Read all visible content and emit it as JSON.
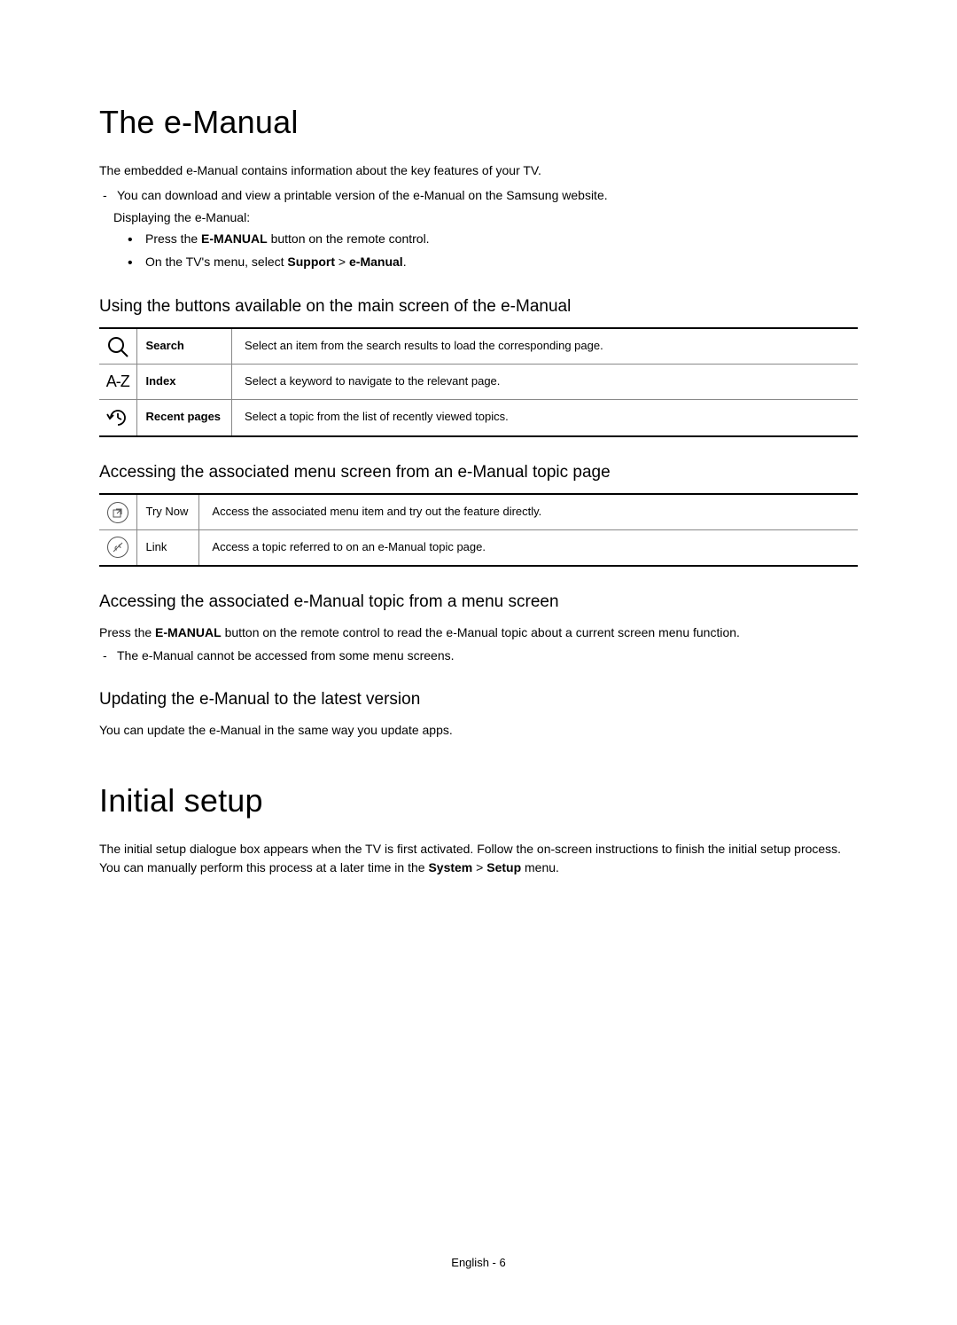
{
  "h1_emanual": "The e-Manual",
  "intro_emanual": "The embedded e-Manual contains information about the key features of your TV.",
  "dash_download": "You can download and view a printable version of the e-Manual on the Samsung website.",
  "displaying_line": "Displaying the e-Manual:",
  "bullet_press_1": "Press the ",
  "bullet_press_bold": "E-MANUAL",
  "bullet_press_2": " button on the remote control.",
  "bullet_menu_1": "On the TV's menu, select ",
  "bullet_menu_bold1": "Support",
  "bullet_menu_gt": " > ",
  "bullet_menu_bold2": "e-Manual",
  "bullet_menu_2": ".",
  "h2_using": "Using the buttons available on the main screen of the e-Manual",
  "table1": {
    "rows": [
      {
        "label": "Search",
        "desc": "Select an item from the search results to load the corresponding page."
      },
      {
        "label": "Index",
        "desc": "Select a keyword to navigate to the relevant page."
      },
      {
        "label": "Recent pages",
        "desc": "Select a topic from the list of recently viewed topics."
      }
    ]
  },
  "h2_accessing_menu": "Accessing the associated menu screen from an e-Manual topic page",
  "table2": {
    "rows": [
      {
        "label": "Try Now",
        "desc": "Access the associated menu item and try out the feature directly."
      },
      {
        "label": "Link",
        "desc": "Access a topic referred to on an e-Manual topic page."
      }
    ]
  },
  "h2_accessing_topic": "Accessing the associated e-Manual topic from a menu screen",
  "access_para_1": "Press the ",
  "access_para_bold": "E-MANUAL",
  "access_para_2": " button on the remote control to read the e-Manual topic about a current screen menu function.",
  "dash_cannot": "The e-Manual cannot be accessed from some menu screens.",
  "h2_updating": "Updating the e-Manual to the latest version",
  "updating_para": "You can update the e-Manual in the same way you update apps.",
  "h1_initial": "Initial setup",
  "initial_para_1": "The initial setup dialogue box appears when the TV is first activated. Follow the on-screen instructions to finish the initial setup process. You can manually perform this process at a later time in the ",
  "initial_bold1": "System",
  "initial_gt": " > ",
  "initial_bold2": "Setup",
  "initial_para_2": " menu.",
  "footer": "English - 6"
}
